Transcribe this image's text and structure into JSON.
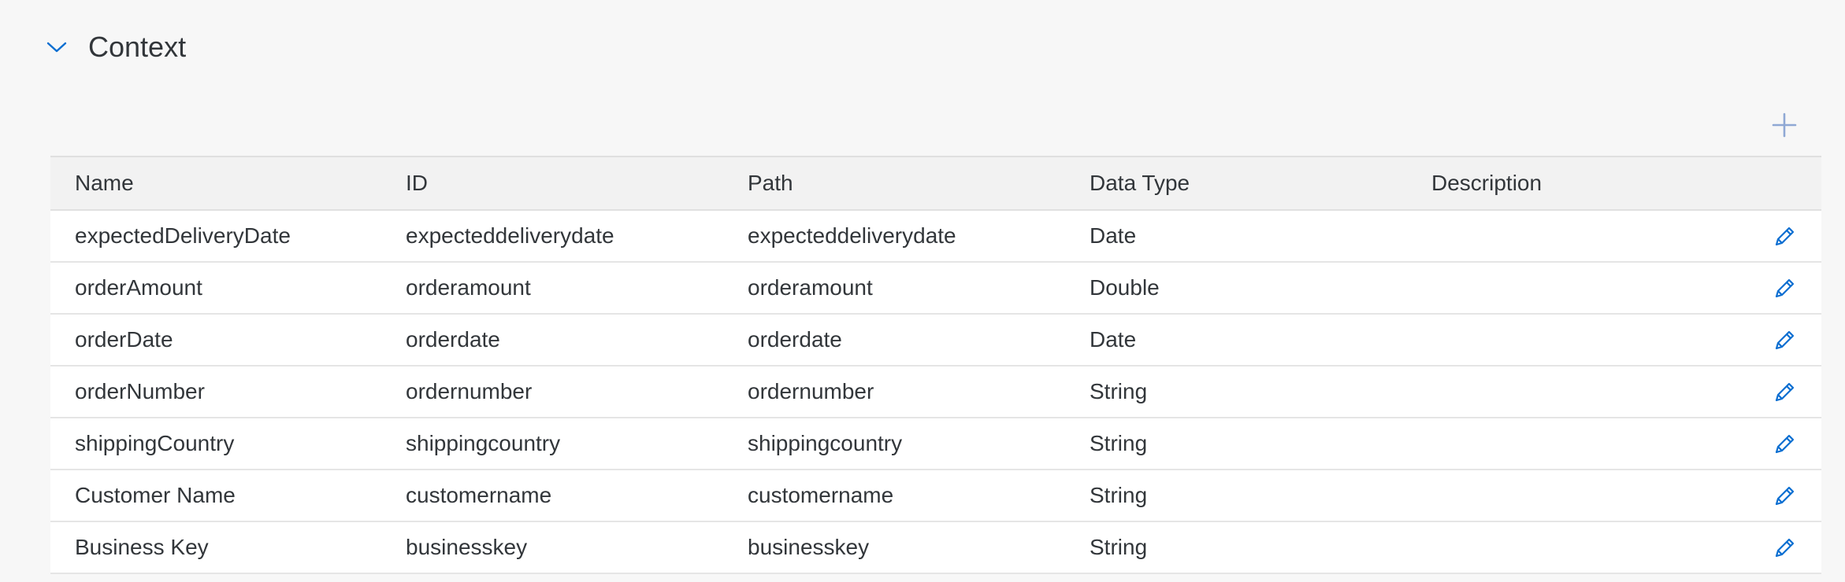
{
  "section": {
    "title": "Context",
    "collapse_icon": "chevron-down-icon",
    "add_icon": "plus-icon"
  },
  "colors": {
    "accent": "#0a6ed1",
    "add_icon": "#8fa8d4",
    "text": "#32363a",
    "background": "#f7f7f7",
    "header_background": "#f2f2f2"
  },
  "table": {
    "columns": [
      "Name",
      "ID",
      "Path",
      "Data Type",
      "Description"
    ],
    "rows": [
      {
        "name": "expectedDeliveryDate",
        "id": "expecteddeliverydate",
        "path": "expecteddeliverydate",
        "type": "Date",
        "description": "",
        "action_icon": "pencil-edit-icon"
      },
      {
        "name": "orderAmount",
        "id": "orderamount",
        "path": "orderamount",
        "type": "Double",
        "description": "",
        "action_icon": "pencil-edit-icon"
      },
      {
        "name": "orderDate",
        "id": "orderdate",
        "path": "orderdate",
        "type": "Date",
        "description": "",
        "action_icon": "pencil-edit-icon"
      },
      {
        "name": "orderNumber",
        "id": "ordernumber",
        "path": "ordernumber",
        "type": "String",
        "description": "",
        "action_icon": "pencil-edit-icon"
      },
      {
        "name": "shippingCountry",
        "id": "shippingcountry",
        "path": "shippingcountry",
        "type": "String",
        "description": "",
        "action_icon": "pencil-edit-icon"
      },
      {
        "name": "Customer Name",
        "id": "customername",
        "path": "customername",
        "type": "String",
        "description": "",
        "action_icon": "pencil-edit-icon"
      },
      {
        "name": "Business Key",
        "id": "businesskey",
        "path": "businesskey",
        "type": "String",
        "description": "",
        "action_icon": "pencil-edit-icon"
      }
    ]
  }
}
